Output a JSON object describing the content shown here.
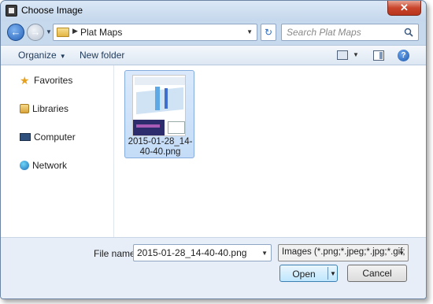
{
  "window": {
    "title": "Choose Image",
    "close_label": "✕"
  },
  "address": {
    "breadcrumb": "Plat Maps",
    "search_placeholder": "Search Plat Maps"
  },
  "toolbar": {
    "organize_label": "Organize",
    "new_folder_label": "New folder",
    "help_label": "?"
  },
  "navpane": {
    "items": [
      {
        "label": "Favorites",
        "icon": "star-icon"
      },
      {
        "label": "Libraries",
        "icon": "libraries-icon"
      },
      {
        "label": "Computer",
        "icon": "computer-icon"
      },
      {
        "label": "Network",
        "icon": "network-icon"
      }
    ]
  },
  "files": [
    {
      "name": "2015-01-28_14-40-40.png",
      "selected": true
    }
  ],
  "bottom": {
    "file_name_label": "File name:",
    "file_name_value": "2015-01-28_14-40-40.png",
    "filter_value": "Images (*.png;*.jpeg;*.jpg;*.gif;",
    "open_label": "Open",
    "cancel_label": "Cancel"
  },
  "colors": {
    "frame": "#c7d9ec",
    "selection": "#c4dcf7",
    "close": "#c9452b"
  }
}
